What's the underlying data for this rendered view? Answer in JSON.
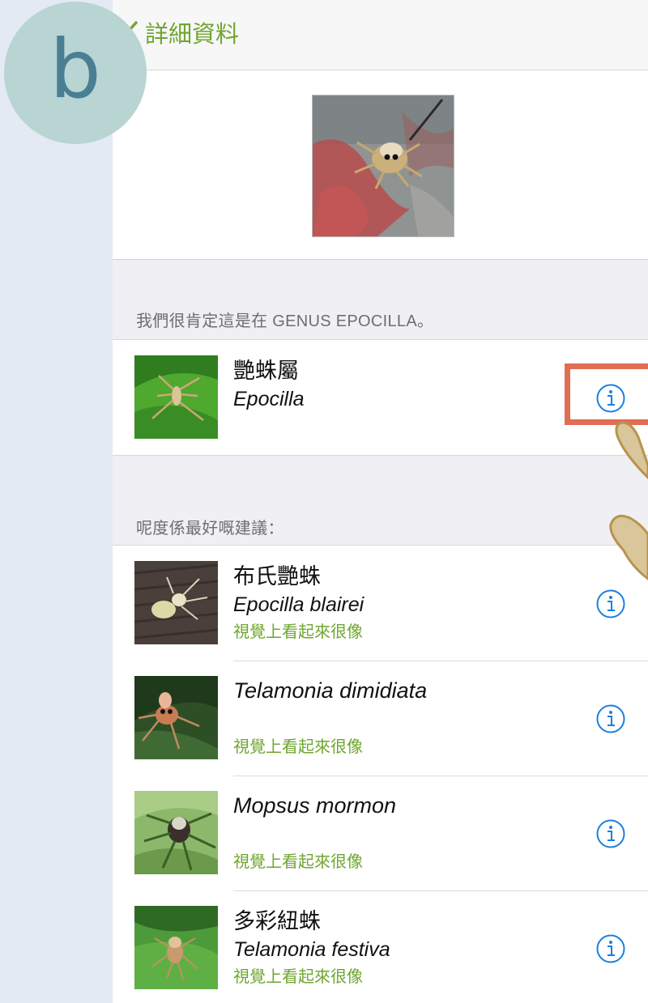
{
  "badge": {
    "letter": "b"
  },
  "navbar": {
    "back_label": "詳細資料"
  },
  "top_suggestion": {
    "header": "我們很肯定這是在 GENUS EPOCILLA。",
    "name": "艷蛛屬",
    "scientific": "Epocilla"
  },
  "suggestions": {
    "header": "呢度係最好嘅建議：",
    "items": [
      {
        "name": "布氏艷蛛",
        "scientific": "Epocilla blairei",
        "hint": "視覺上看起來很像"
      },
      {
        "name": "",
        "scientific": "Telamonia dimidiata",
        "hint": "視覺上看起來很像"
      },
      {
        "name": "",
        "scientific": "Mopsus mormon",
        "hint": "視覺上看起來很像"
      },
      {
        "name": "多彩紐蛛",
        "scientific": "Telamonia festiva",
        "hint": "視覺上看起來很像"
      }
    ]
  },
  "colors": {
    "accent": "#6fa62f",
    "info_icon": "#1a7fe0",
    "highlight": "#e16d52",
    "badge": "#b8d4d3"
  }
}
